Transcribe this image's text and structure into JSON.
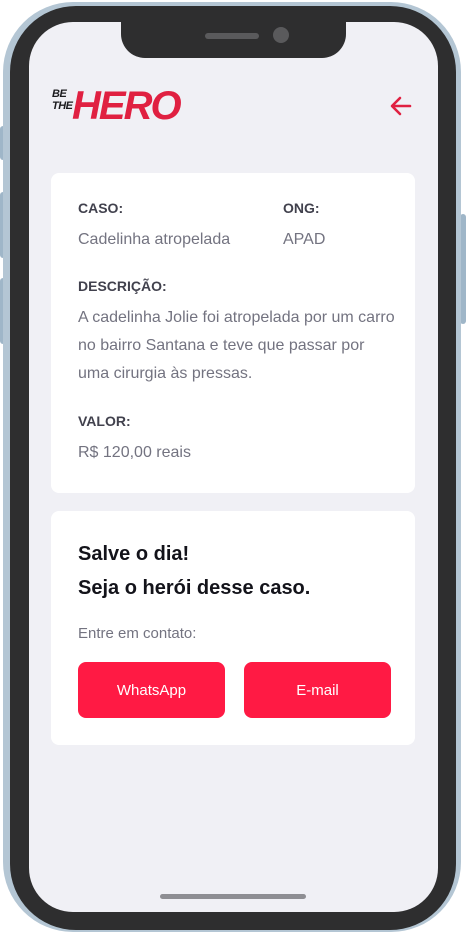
{
  "brand": {
    "logo_small": "BE THE",
    "logo_big": "HERO",
    "accent_color": "#e02041",
    "button_color": "#ff1a44"
  },
  "header": {
    "back_icon": "arrow-left-icon"
  },
  "incident": {
    "case_label": "CASO:",
    "case_value": "Cadelinha atropelada",
    "ong_label": "ONG:",
    "ong_value": "APAD",
    "description_label": "DESCRIÇÃO:",
    "description_value": "A cadelinha Jolie foi atropelada por um carro no bairro Santana e teve que passar por uma cirurgia às pressas.",
    "value_label": "VALOR:",
    "value_value": "R$ 120,00 reais"
  },
  "contact": {
    "title_line1": "Salve o dia!",
    "title_line2": "Seja o herói desse caso.",
    "prompt": "Entre em contato:",
    "whatsapp_label": "WhatsApp",
    "email_label": "E-mail"
  }
}
